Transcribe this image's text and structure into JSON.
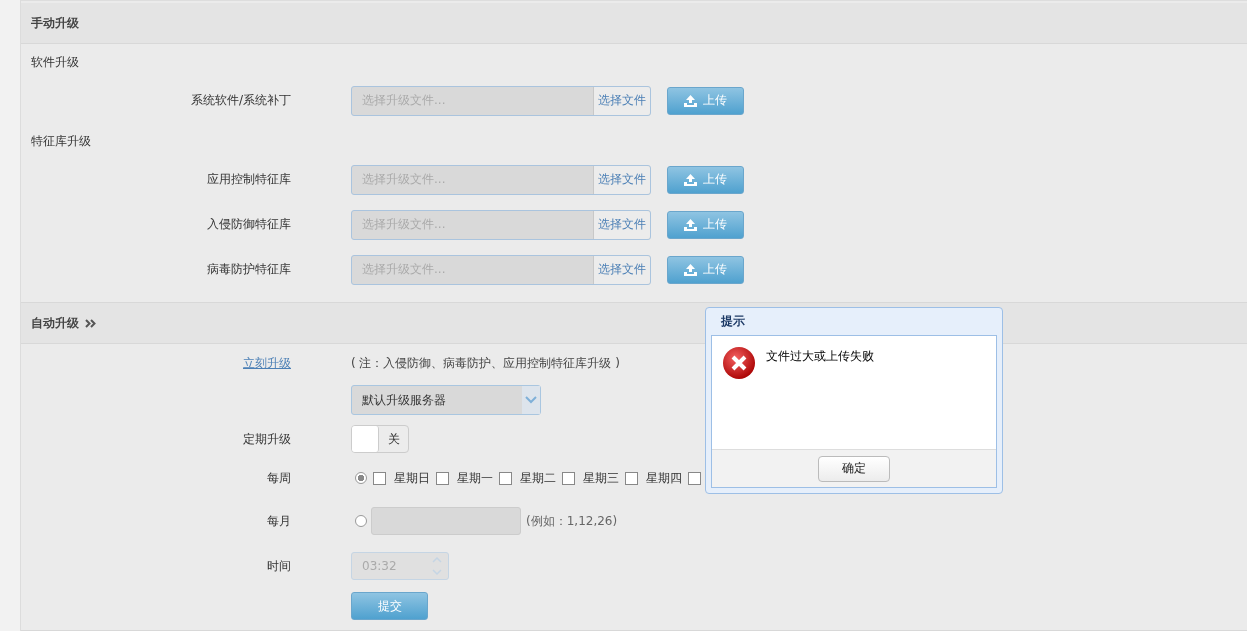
{
  "manual_upgrade": {
    "title": "手动升级",
    "groups": [
      {
        "heading": "软件升级",
        "items": [
          {
            "label": "系统软件/系统补丁",
            "placeholder": "选择升级文件...",
            "browse": "选择文件",
            "upload": "上传"
          }
        ]
      },
      {
        "heading": "特征库升级",
        "items": [
          {
            "label": "应用控制特征库",
            "placeholder": "选择升级文件...",
            "browse": "选择文件",
            "upload": "上传"
          },
          {
            "label": "入侵防御特征库",
            "placeholder": "选择升级文件...",
            "browse": "选择文件",
            "upload": "上传"
          },
          {
            "label": "病毒防护特征库",
            "placeholder": "选择升级文件...",
            "browse": "选择文件",
            "upload": "上传"
          }
        ]
      }
    ]
  },
  "auto_upgrade": {
    "title": "自动升级",
    "upgrade_now": "立刻升级",
    "note": "( 注：入侵防御、病毒防护、应用控制特征库升级 )",
    "server_select": {
      "value": "默认升级服务器"
    },
    "scheduled": {
      "label": "定期升级",
      "on": false,
      "state_text": "关"
    },
    "weekly": {
      "label": "每周",
      "selected": true,
      "days": [
        {
          "label": "星期日",
          "checked": false
        },
        {
          "label": "星期一",
          "checked": false
        },
        {
          "label": "星期二",
          "checked": false
        },
        {
          "label": "星期三",
          "checked": false
        },
        {
          "label": "星期四",
          "checked": false
        },
        {
          "checked": false
        }
      ]
    },
    "monthly": {
      "label": "每月",
      "selected": false,
      "hint": "(例如：1,12,26)"
    },
    "time": {
      "label": "时间",
      "value": "03:32"
    },
    "submit": "提交"
  },
  "dialog": {
    "title": "提示",
    "message": "文件过大或上传失败",
    "ok": "确定"
  }
}
